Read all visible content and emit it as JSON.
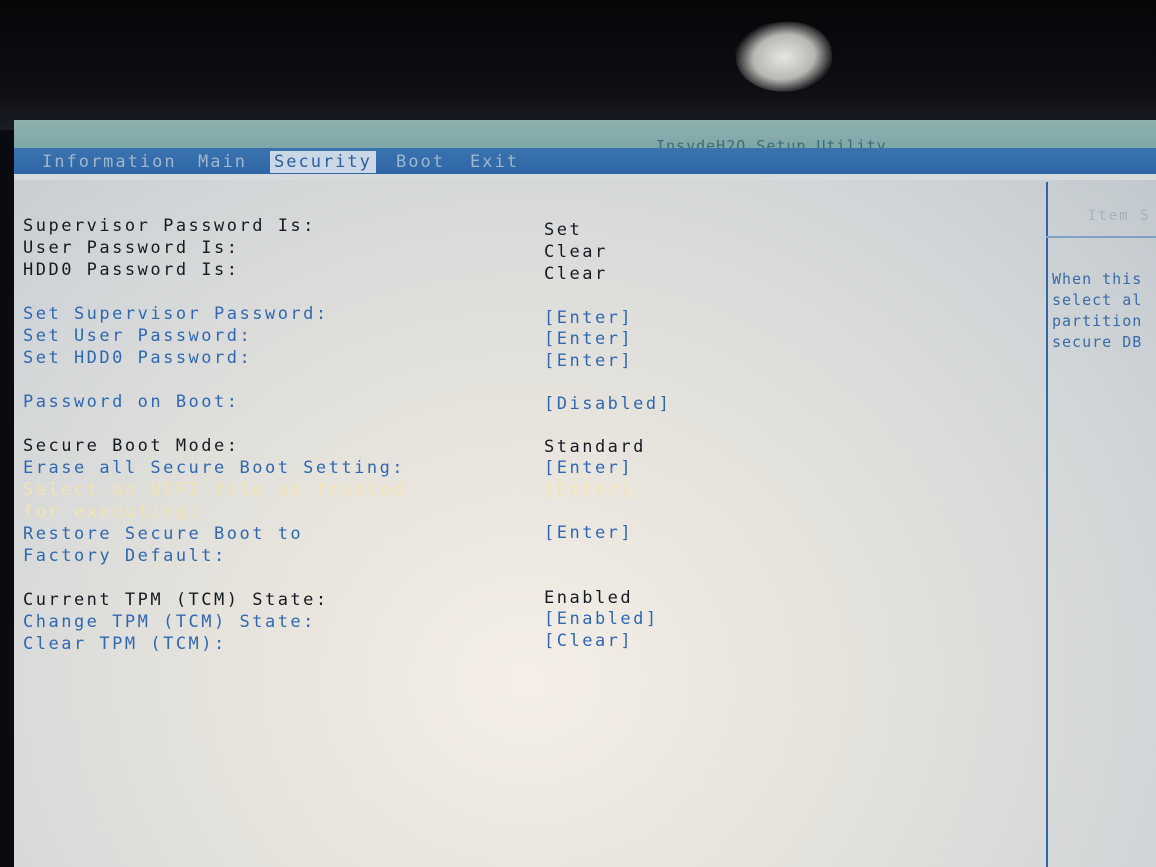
{
  "utility_title": "InsydeH2O Setup Utility",
  "tabs": [
    {
      "label": "Information"
    },
    {
      "label": "Main"
    },
    {
      "label": "Security"
    },
    {
      "label": "Boot"
    },
    {
      "label": "Exit"
    }
  ],
  "active_tab": "Security",
  "items": {
    "supervisor_password_is": {
      "label": "Supervisor Password Is:",
      "value": "Set"
    },
    "user_password_is": {
      "label": "User Password Is:",
      "value": "Clear"
    },
    "hdd0_password_is": {
      "label": "HDD0 Password Is:",
      "value": "Clear"
    },
    "set_supervisor_password": {
      "label": "Set Supervisor Password:",
      "value": "[Enter]"
    },
    "set_user_password": {
      "label": "Set User Password:",
      "value": "[Enter]"
    },
    "set_hdd0_password": {
      "label": "Set HDD0 Password:",
      "value": "[Enter]"
    },
    "password_on_boot": {
      "label": "Password on Boot:",
      "value": "[Disabled]"
    },
    "secure_boot_mode": {
      "label": "Secure Boot Mode:",
      "value": "Standard"
    },
    "erase_secure_boot": {
      "label": "Erase all Secure Boot Setting:",
      "value": "[Enter]"
    },
    "select_uefi_file": {
      "label_line1": "Select an UEFI file as trusted",
      "label_line2": "for executing:",
      "value": "[Enter]"
    },
    "restore_secure_boot": {
      "label_line1": "Restore Secure Boot to",
      "label_line2": "Factory Default:",
      "value": "[Enter]"
    },
    "current_tpm_state": {
      "label": "Current TPM (TCM) State:",
      "value": "Enabled"
    },
    "change_tpm_state": {
      "label": "Change TPM (TCM) State:",
      "value": "[Enabled]"
    },
    "clear_tpm": {
      "label": "Clear TPM (TCM):",
      "value": "[Clear]"
    }
  },
  "help": {
    "title": "Item S",
    "lines": [
      "When this",
      "select al",
      "partition",
      "secure DB"
    ]
  },
  "colors": {
    "menu_bar": "#2f66a6",
    "selectable_text": "#2f68b2",
    "static_text": "#151b22",
    "highlighted_text": "#f3e3b0"
  }
}
